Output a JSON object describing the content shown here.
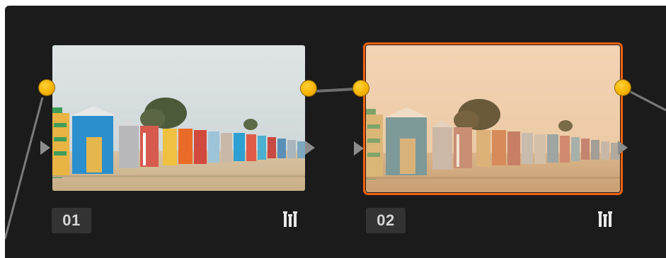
{
  "nodes": [
    {
      "label": "01",
      "selected": false,
      "icon": "bars-icon"
    },
    {
      "label": "02",
      "selected": true,
      "icon": "bars-icon"
    }
  ],
  "colors": {
    "background": "#1b1b1b",
    "connector": "#6e6e6e",
    "input_dot": "#f6b400",
    "selection_outline": "#f0620f",
    "label_background": "#333333"
  }
}
